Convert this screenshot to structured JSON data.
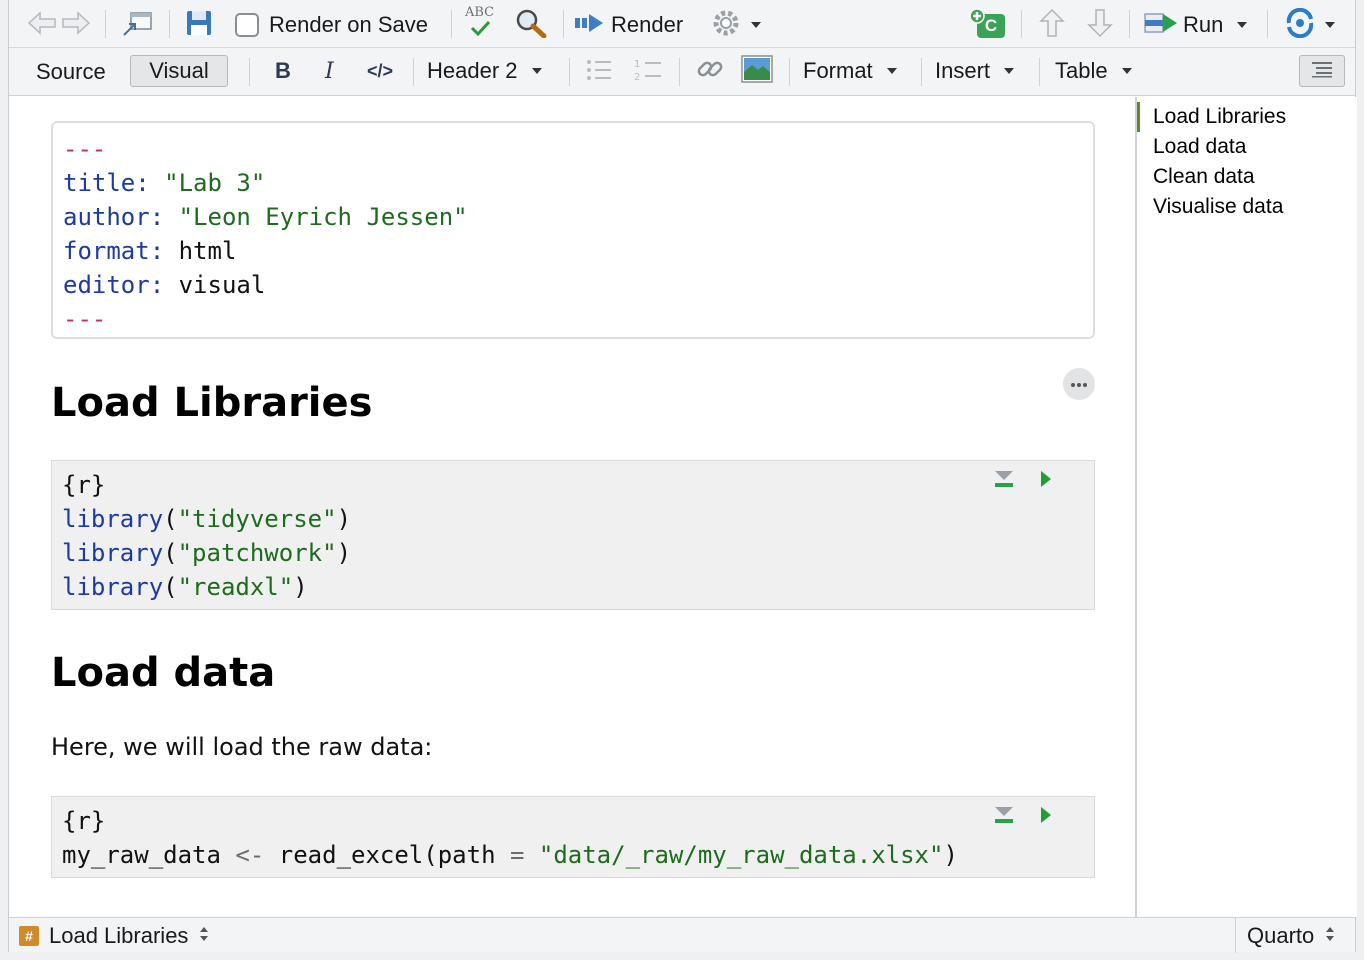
{
  "toolbar": {
    "render_on_save_label": "Render on Save",
    "render_on_save_checked": false,
    "spellcheck_text": "ABC",
    "render_label": "Render",
    "run_label": "Run",
    "insert_chunk_letter": "C"
  },
  "format_bar": {
    "source_label": "Source",
    "visual_label": "Visual",
    "active_mode": "Visual",
    "bold_label": "B",
    "italic_label": "I",
    "code_label": "</>",
    "heading_select": "Header 2",
    "format_label": "Format",
    "insert_label": "Insert",
    "table_label": "Table"
  },
  "yaml": {
    "delim": "---",
    "title_key": "title:",
    "title_val": "\"Lab 3\"",
    "author_key": "author:",
    "author_val": "\"Leon Eyrich Jessen\"",
    "format_key": "format:",
    "format_val": "html",
    "editor_key": "editor:",
    "editor_val": "visual"
  },
  "sections": {
    "h1": "Load Libraries",
    "h2": "Load data",
    "para": "Here, we will load the raw data:"
  },
  "chunk1": {
    "header": "{r}",
    "fn": "library",
    "lib1": "\"tidyverse\"",
    "lib2": "\"patchwork\"",
    "lib3": "\"readxl\""
  },
  "chunk2": {
    "header": "{r}",
    "var": "my_raw_data",
    "assign": "<-",
    "fn": "read_excel",
    "arg": "path",
    "eq": "=",
    "path_val": "\"data/_raw/my_raw_data.xlsx\""
  },
  "outline": [
    "Load Libraries",
    "Load data",
    "Clean data",
    "Visualise data"
  ],
  "status": {
    "section": "Load Libraries",
    "hash": "#",
    "filetype": "Quarto"
  },
  "colors": {
    "keyword": "#1b3aa3",
    "string": "#1d6b1d",
    "yaml_delim": "#c22c6d",
    "run_green": "#1e9e3a",
    "outline_active": "#5a8a2a"
  }
}
